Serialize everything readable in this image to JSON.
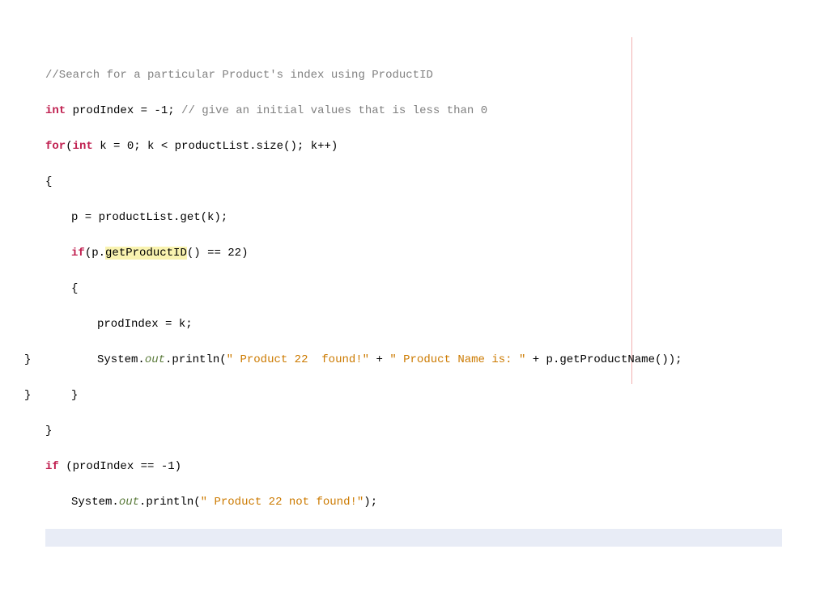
{
  "code": {
    "l1_comment": "//Search for a particular Product's index using ProductID",
    "l2_kw_int": "int",
    "l2_ident": " prodIndex = -1; ",
    "l2_comment": "// give an initial values that is less than 0",
    "l3_kw_for": "for",
    "l3_rest_a": "(",
    "l3_kw_int2": "int",
    "l3_rest_b": " k = 0; k < productList.size(); k++)",
    "l4_brace": "{",
    "l5_text": "p = productList.get(k);",
    "l6_kw_if": "if",
    "l6_a": "(p.",
    "l6_hl": "getProductID",
    "l6_b": "() == 22)",
    "l7_brace": "{",
    "l8_text": "prodIndex = k;",
    "l9_a": "System.",
    "l9_out": "out",
    "l9_b": ".println(",
    "l9_s1": "\" Product 22  found!\"",
    "l9_c": " + ",
    "l9_s2": "\" Product Name is: \"",
    "l9_d": " + p.getProductName());",
    "l10_brace": "}",
    "l11_brace": "}",
    "l12_kw_if": "if",
    "l12_rest": " (prodIndex == -1)",
    "l13_a": "System.",
    "l13_out": "out",
    "l13_b": ".println(",
    "l13_s1": "\" Product 22 not found!\"",
    "l13_c": ");",
    "l16_brace": "}",
    "l17_brace": "}"
  }
}
